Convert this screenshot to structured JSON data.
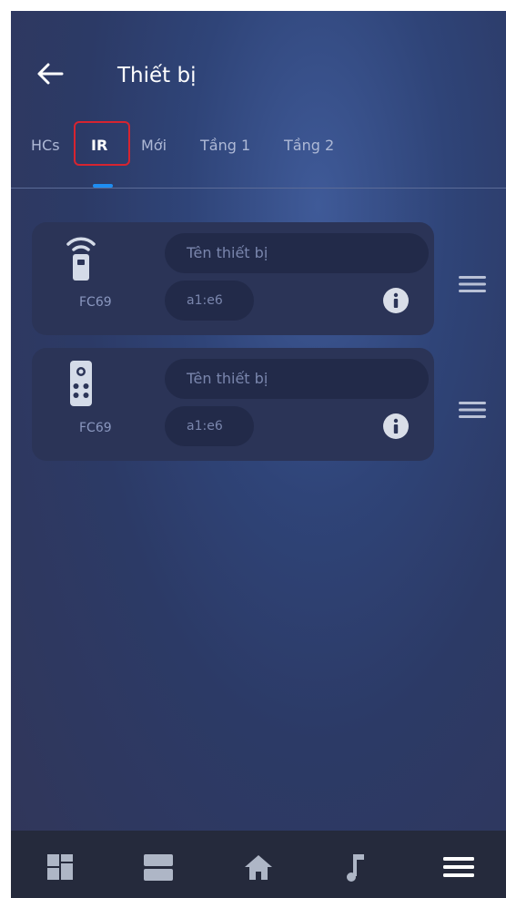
{
  "header": {
    "title": "Thiết bị",
    "back_icon": "arrow-left-icon"
  },
  "tabs": [
    {
      "label": "HCs",
      "active": false
    },
    {
      "label": "IR",
      "active": true
    },
    {
      "label": "Mới",
      "active": false
    },
    {
      "label": "Tầng 1",
      "active": false
    },
    {
      "label": "Tầng 2",
      "active": false
    }
  ],
  "devices": [
    {
      "icon": "wifi-remote-icon",
      "code": "FC69",
      "name_placeholder": "Tên thiết bị",
      "address": "a1:e6"
    },
    {
      "icon": "remote-control-icon",
      "code": "FC69",
      "name_placeholder": "Tên thiết bị",
      "address": "a1:e6"
    }
  ],
  "bottom_nav": [
    {
      "icon": "dashboard-grid-icon"
    },
    {
      "icon": "rooms-list-icon"
    },
    {
      "icon": "home-icon"
    },
    {
      "icon": "music-note-icon"
    },
    {
      "icon": "menu-icon"
    }
  ],
  "colors": {
    "accent": "#1e8df2",
    "highlight_box": "#d62430",
    "card_bg": "#2b3457",
    "nav_bg": "#252a3c"
  }
}
